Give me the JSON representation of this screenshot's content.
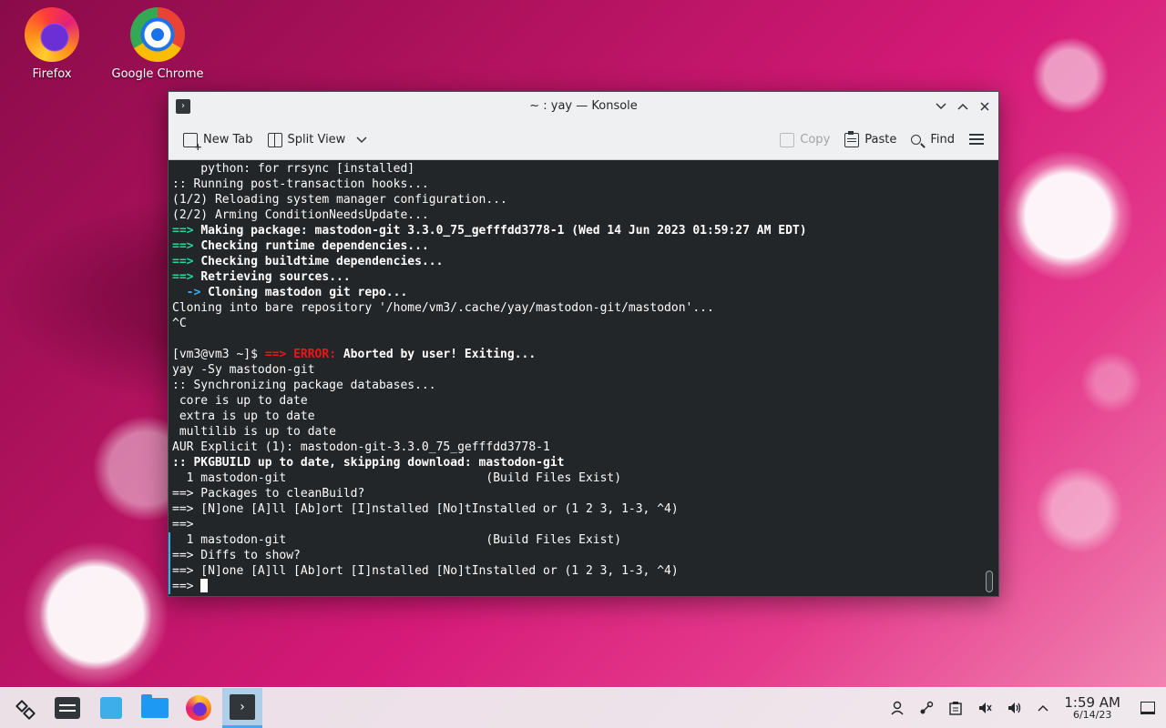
{
  "desktop": {
    "icons": [
      {
        "label": "Firefox"
      },
      {
        "label": "Google Chrome"
      }
    ]
  },
  "window": {
    "title": "~ : yay — Konsole",
    "toolbar": {
      "new_tab": "New Tab",
      "split_view": "Split View",
      "copy": "Copy",
      "paste": "Paste",
      "find": "Find"
    }
  },
  "terminal": {
    "lines": [
      "    python: for rrsync [installed]",
      ":: Running post-transaction hooks...",
      "(1/2) Reloading system manager configuration...",
      "(2/2) Arming ConditionNeedsUpdate...",
      {
        "arrow": "==> ",
        "text": "Making package: mastodon-git 3.3.0_75_gefffdd3778-1 (Wed 14 Jun 2023 01:59:27 AM EDT)"
      },
      {
        "arrow": "==> ",
        "text": "Checking runtime dependencies..."
      },
      {
        "arrow": "==> ",
        "text": "Checking buildtime dependencies..."
      },
      {
        "arrow": "==> ",
        "text": "Retrieving sources..."
      },
      {
        "sub_arrow": "  -> ",
        "text": "Cloning mastodon git repo..."
      },
      "Cloning into bare repository '/home/vm3/.cache/yay/mastodon-git/mastodon'...",
      "^C",
      "",
      {
        "prompt": "[vm3@vm3 ~]$ ",
        "err_arrow": "==> ",
        "err_label": "ERROR:",
        "text": " Aborted by user! Exiting..."
      },
      "yay -Sy mastodon-git",
      ":: Synchronizing package databases...",
      " core is up to date",
      " extra is up to date",
      " multilib is up to date",
      "AUR Explicit (1): mastodon-git-3.3.0_75_gefffdd3778-1",
      {
        "bold": ":: PKGBUILD up to date, skipping download: mastodon-git"
      },
      "  1 mastodon-git                            (Build Files Exist)",
      "==> Packages to cleanBuild?",
      "==> [N]one [A]ll [Ab]ort [I]nstalled [No]tInstalled or (1 2 3, 1-3, ^4)",
      "==>",
      "  1 mastodon-git                            (Build Files Exist)",
      "==> Diffs to show?",
      "==> [N]one [A]ll [Ab]ort [I]nstalled [No]tInstalled or (1 2 3, 1-3, ^4)",
      {
        "input_prompt": "==> "
      }
    ]
  },
  "taskbar": {
    "clock_time": "1:59 AM",
    "clock_date": "6/14/23"
  },
  "colors": {
    "terminal_bg": "#232629",
    "accent_green": "#1cdc9a",
    "accent_blue": "#3daee9",
    "error_red": "#ed1515"
  }
}
